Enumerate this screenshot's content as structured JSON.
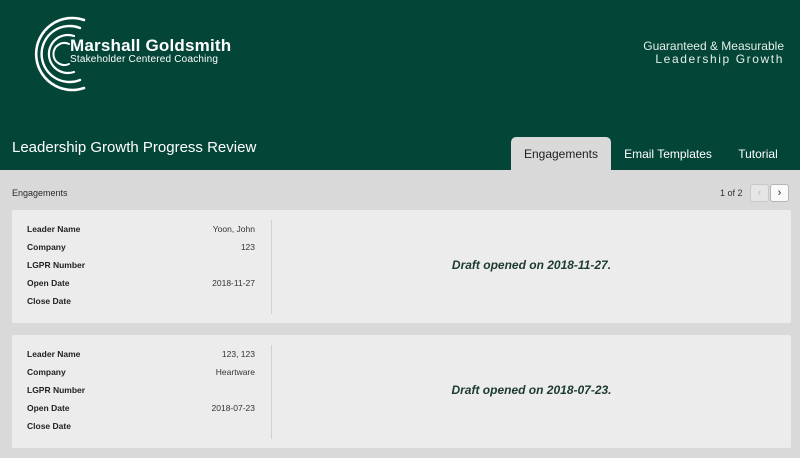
{
  "header": {
    "brand_name": "Marshall Goldsmith",
    "brand_sub": "Stakeholder Centered Coaching",
    "tagline_line1": "Guaranteed & Measurable",
    "tagline_line2": "Leadership Growth",
    "bg_color": "#034637"
  },
  "page_title": "Leadership Growth Progress Review",
  "tabs": [
    {
      "label": "Engagements",
      "active": true
    },
    {
      "label": "Email Templates",
      "active": false
    },
    {
      "label": "Tutorial",
      "active": false
    }
  ],
  "section_label": "Engagements",
  "pager": {
    "text": "1 of 2",
    "prev_icon": "chevron-left-icon",
    "next_icon": "chevron-right-icon"
  },
  "field_labels": {
    "leader_name": "Leader Name",
    "company": "Company",
    "lgpr_number": "LGPR Number",
    "open_date": "Open Date",
    "close_date": "Close Date"
  },
  "engagements": [
    {
      "leader_name": "Yoon, John",
      "company": "123",
      "lgpr_number": "",
      "open_date": "2018-11-27",
      "close_date": "",
      "status": "Draft opened on 2018-11-27."
    },
    {
      "leader_name": "123, 123",
      "company": "Heartware",
      "lgpr_number": "",
      "open_date": "2018-07-23",
      "close_date": "",
      "status": "Draft opened on 2018-07-23."
    }
  ]
}
